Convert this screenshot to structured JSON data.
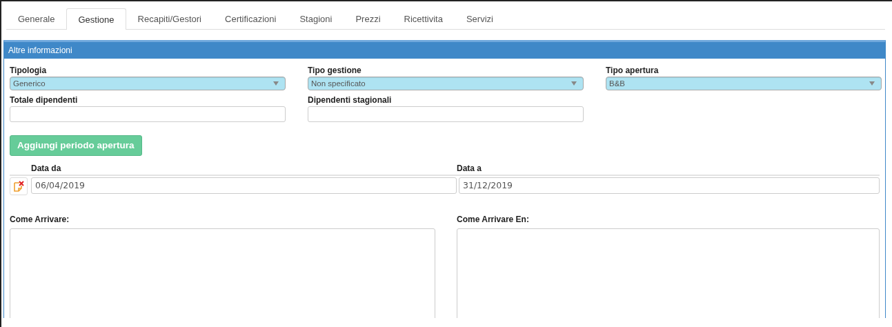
{
  "tabs": [
    {
      "label": "Generale",
      "selected": false
    },
    {
      "label": "Gestione",
      "selected": true
    },
    {
      "label": "Recapiti/Gestori",
      "selected": false
    },
    {
      "label": "Certificazioni",
      "selected": false
    },
    {
      "label": "Stagioni",
      "selected": false
    },
    {
      "label": "Prezzi",
      "selected": false
    },
    {
      "label": "Ricettivita",
      "selected": false
    },
    {
      "label": "Servizi",
      "selected": false
    }
  ],
  "panel": {
    "title": "Altre informazioni",
    "selects": [
      {
        "label": "Tipologia",
        "value": "Generico"
      },
      {
        "label": "Tipo gestione",
        "value": "Non specificato"
      },
      {
        "label": "Tipo apertura",
        "value": "B&B"
      }
    ],
    "fields": [
      {
        "label": "Totale dipendenti"
      },
      {
        "label": "Dipendenti stagionali"
      }
    ],
    "add_button": "Aggiungi periodo apertura",
    "periods": {
      "columns": [
        "Data da",
        "Data a"
      ],
      "rows": [
        {
          "from": "06/04/2019",
          "to": "31/12/2019"
        }
      ]
    },
    "textareas": [
      {
        "label": "Come Arrivare:"
      },
      {
        "label": "Come Arrivare En:"
      }
    ]
  }
}
